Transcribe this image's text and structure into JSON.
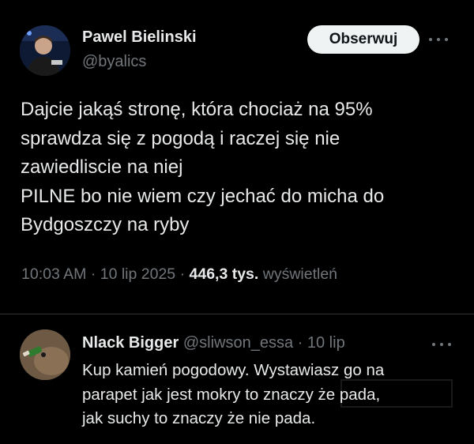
{
  "post": {
    "author_name": "Pawel Bielinski",
    "author_handle": "@byalics",
    "follow_label": "Obserwuj",
    "more_icon": "more-horizontal-icon",
    "text_lines": [
      "Dajcie jakąś stronę, która chociaż na 95%",
      "sprawdza się z pogodą i raczej się nie",
      "zawiedliscie na niej",
      "PILNE bo nie wiem czy jechać do micha do",
      "Bydgoszczy na ryby"
    ],
    "time": "10:03 AM",
    "separator": "·",
    "date": "10 lip 2025",
    "views_count": "446,3 tys.",
    "views_label": "wyświetleń"
  },
  "reply": {
    "author_name": "Nlack Bigger",
    "author_handle": "@sliwson_essa",
    "separator": "·",
    "date": "10 lip",
    "more_icon": "more-horizontal-icon",
    "text_lines": [
      "Kup kamień pogodowy. Wystawiasz go na",
      "parapet jak jest mokry to znaczy że pada,",
      "jak suchy to znaczy że nie pada."
    ]
  },
  "colors": {
    "background": "#000000",
    "text_primary": "#e7e9ea",
    "text_secondary": "#71767b",
    "divider": "#2f3336",
    "follow_button_bg": "#eff3f4"
  }
}
